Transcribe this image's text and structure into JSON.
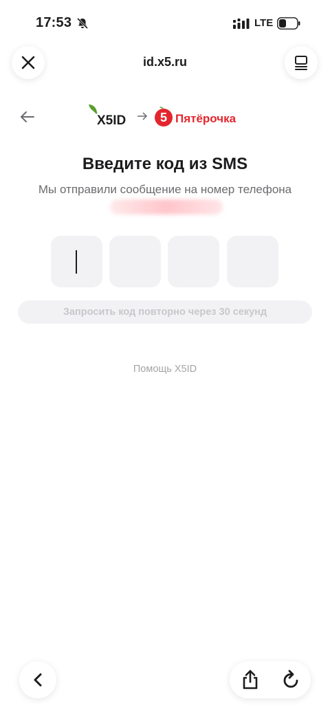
{
  "status_bar": {
    "time": "17:53",
    "network": "LTE",
    "icons": [
      "bell-slash-icon",
      "signal-icon",
      "battery-icon"
    ]
  },
  "browser": {
    "url": "id.x5.ru",
    "icons": [
      "close-icon",
      "menu-icon",
      "chevron-left-icon",
      "share-icon",
      "reload-icon"
    ]
  },
  "brand": {
    "x5_logo_text": "X5ID",
    "partner_logo_text": "Пятёрочка",
    "partner_logo_digit": "5",
    "colors": {
      "x5_green": "#5a9e2f",
      "pyaterochka_red": "#e3262e"
    }
  },
  "page": {
    "title": "Введите код из SMS",
    "subtitle": "Мы отправили сообщение на номер телефона",
    "resend_label": "Запросить код повторно через 30 секунд",
    "help_link": "Помощь X5ID"
  },
  "code_input": {
    "digits": [
      "",
      "",
      "",
      ""
    ]
  }
}
